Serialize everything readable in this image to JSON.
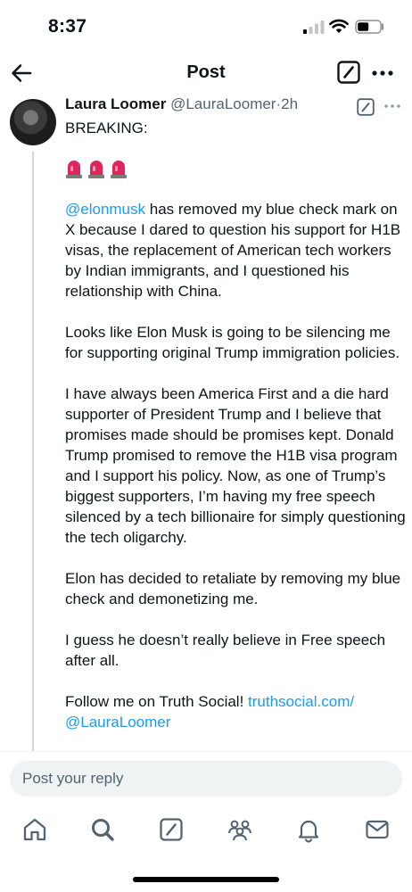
{
  "status_bar": {
    "time": "8:37"
  },
  "nav": {
    "title": "Post"
  },
  "post": {
    "author_name": "Laura Loomer",
    "author_handle": "@LauraLoomer",
    "separator": "·",
    "time_ago": "2h",
    "opening": "BREAKING:",
    "sirens": [
      "🚨",
      "🚨",
      "🚨"
    ],
    "mention": "@elonmusk",
    "p1_rest": " has removed my blue check mark on X because I dared to question his support for H1B visas, the replacement of American tech workers by Indian immigrants, and I questioned his relationship with China.",
    "p2": "Looks like Elon Musk is going to be silencing me for supporting original Trump immigration policies.",
    "p3": "I have always been America First and a die hard supporter of President Trump and I believe that promises made should be promises kept. Donald Trump promised to remove the H1B visa program and I support his policy. Now, as one of Trump’s biggest supporters, I’m having my free speech silenced by a tech billionaire for simply questioning the tech oligarchy.",
    "p4": "Elon has decided to retaliate by removing my blue check and demonetizing me.",
    "p5": "I guess he doesn’t really believe in Free speech after all.",
    "p6_prefix": "Follow me on Truth Social! ",
    "p6_link": "truthsocial.com/",
    "p6_link2": "@LauraLoomer"
  },
  "reply": {
    "placeholder": "Post your reply"
  },
  "tabbar": {
    "icons": [
      "home-icon",
      "search-icon",
      "compose-icon",
      "communities-icon",
      "notifications-icon",
      "messages-icon"
    ]
  },
  "colors": {
    "link": "#1d9bf0",
    "text": "#0f1419",
    "muted": "#536471",
    "siren": "#e0245e"
  }
}
